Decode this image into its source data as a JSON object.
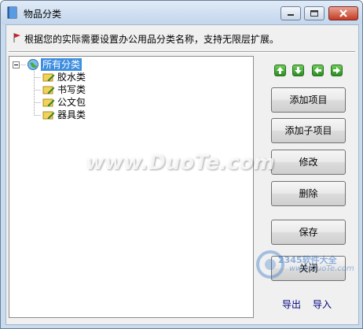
{
  "window": {
    "title": "物品分类"
  },
  "hint": {
    "text": "根据您的实际需要设置办公用品分类名称，支持无限层扩展。"
  },
  "tree": {
    "root": "所有分类",
    "children": [
      "胶水类",
      "书写类",
      "公文包",
      "器具类"
    ]
  },
  "buttons": {
    "add_item": "添加项目",
    "add_sub_item": "添加子项目",
    "edit": "修改",
    "delete": "删除",
    "save": "保存",
    "close": "关闭"
  },
  "links": {
    "export": "导出",
    "import": "导入"
  },
  "watermark": {
    "center": "www.DuoTe.com",
    "corner": "2345软件大全",
    "corner_url": "www.DuoTe.com"
  },
  "colors": {
    "selection": "#3d8ee0",
    "arrow_green": "#3fa631",
    "titlebar": "#c9dbee"
  }
}
